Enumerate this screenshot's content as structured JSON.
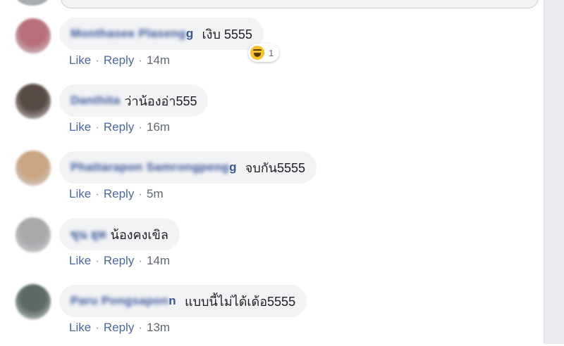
{
  "comments": [
    {
      "author_prefix": "Monthasee Plaseng",
      "author_suffix": "g",
      "text": "เงิบ 5555",
      "like": "Like",
      "reply": "Reply",
      "time": "14m",
      "reaction": {
        "icon": "haha-icon",
        "count": "1"
      },
      "avatar_color": "#b7707a"
    },
    {
      "author_prefix": "Danthita",
      "author_suffix": "",
      "text": "ว่าน้องอ่า555",
      "like": "Like",
      "reply": "Reply",
      "time": "16m",
      "avatar_color": "#5a4a44"
    },
    {
      "author_prefix": "Phattarapon Samrongpeng",
      "author_suffix": "g",
      "text": "จบกัน5555",
      "like": "Like",
      "reply": "Reply",
      "time": "5m",
      "avatar_color": "#c9a582"
    },
    {
      "author_prefix": "ขุน ยุท",
      "author_suffix": "",
      "text": "น้องคงเขิล",
      "like": "Like",
      "reply": "Reply",
      "time": "14m",
      "avatar_color": "#a9a9ac"
    },
    {
      "author_prefix": "Paru Pongsapon",
      "author_suffix": "n",
      "text": "แบบนี้ไม่ได้เด้อ5555",
      "like": "Like",
      "reply": "Reply",
      "time": "13m",
      "avatar_color": "#5c6b67"
    }
  ]
}
